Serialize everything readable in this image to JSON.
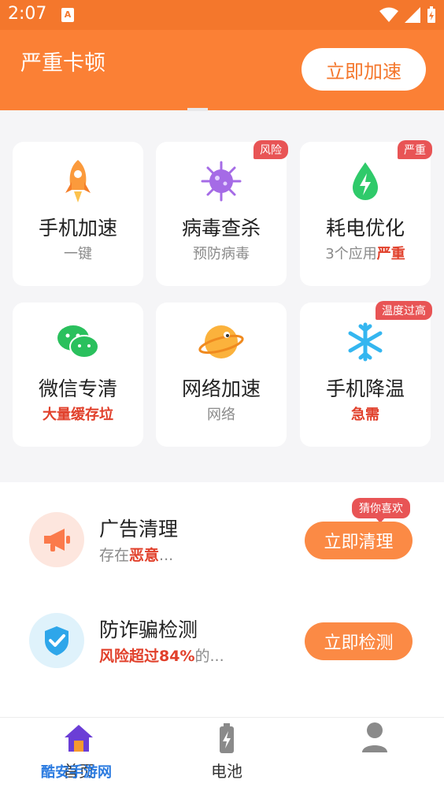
{
  "status_bar": {
    "time": "2:07",
    "app_icon_letter": "A"
  },
  "header": {
    "title": "严重卡顿",
    "speed_button": "立即加速"
  },
  "grid": [
    {
      "title": "手机加速",
      "sub": "一键",
      "icon": "rocket-icon",
      "badge": ""
    },
    {
      "title": "病毒查杀",
      "sub": "预防病毒",
      "icon": "virus-icon",
      "badge": "风险"
    },
    {
      "title": "耗电优化",
      "sub_prefix": "3个应用",
      "sub_highlight": "严重",
      "icon": "battery-drop-icon",
      "badge": "严重"
    },
    {
      "title": "微信专清",
      "sub": "大量缓存垃",
      "icon": "wechat-icon",
      "badge": ""
    },
    {
      "title": "网络加速",
      "sub": "网络",
      "icon": "planet-icon",
      "badge": ""
    },
    {
      "title": "手机降温",
      "sub": "急需",
      "icon": "snowflake-icon",
      "badge": "温度过高"
    }
  ],
  "list": [
    {
      "name": "广告清理",
      "desc_prefix": "存在",
      "desc_highlight": "恶意",
      "desc_suffix": "...",
      "action": "立即清理",
      "icon": "megaphone-icon"
    },
    {
      "name": "防诈骗检测",
      "desc_prefix": "",
      "desc_highlight": "风险超过84%",
      "desc_suffix": "的...",
      "action": "立即检测",
      "icon": "shield-check-icon"
    }
  ],
  "like_badge": "猜你喜欢",
  "bottom_nav": [
    {
      "label": "首页",
      "icon": "home-icon",
      "active": true
    },
    {
      "label": "电池",
      "icon": "battery-icon",
      "active": false
    },
    {
      "label": "",
      "icon": "user-icon",
      "active": false
    }
  ],
  "watermark": "酷安手游网",
  "colors": {
    "brand_orange": "#fb8035",
    "warn_red": "#e1402b",
    "badge_red": "#e85455"
  }
}
